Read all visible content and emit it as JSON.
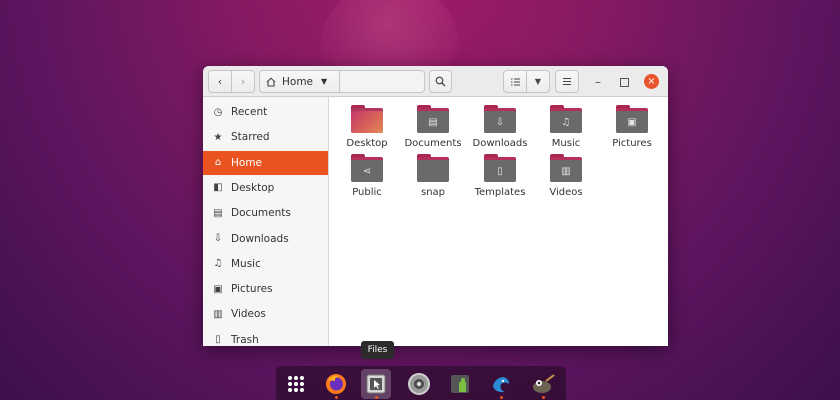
{
  "window": {
    "path_label": "Home",
    "close_glyph": "×",
    "min_glyph": "–",
    "back_glyph": "‹",
    "forward_glyph": "›"
  },
  "sidebar": {
    "items": [
      {
        "label": "Recent",
        "icon": "clock-icon",
        "glyph": "◷"
      },
      {
        "label": "Starred",
        "icon": "star-icon",
        "glyph": "★"
      },
      {
        "label": "Home",
        "icon": "home-icon",
        "glyph": "⌂"
      },
      {
        "label": "Desktop",
        "icon": "desktop-icon",
        "glyph": "◧"
      },
      {
        "label": "Documents",
        "icon": "documents-icon",
        "glyph": "▤"
      },
      {
        "label": "Downloads",
        "icon": "downloads-icon",
        "glyph": "⇩"
      },
      {
        "label": "Music",
        "icon": "music-icon",
        "glyph": "♫"
      },
      {
        "label": "Pictures",
        "icon": "pictures-icon",
        "glyph": "▣"
      },
      {
        "label": "Videos",
        "icon": "videos-icon",
        "glyph": "▥"
      },
      {
        "label": "Trash",
        "icon": "trash-icon",
        "glyph": "▯"
      }
    ],
    "active_index": 2
  },
  "files": [
    {
      "name": "Desktop",
      "icon": "desktop-folder-icon",
      "glyph": ""
    },
    {
      "name": "Documents",
      "icon": "documents-folder-icon",
      "glyph": "▤"
    },
    {
      "name": "Downloads",
      "icon": "downloads-folder-icon",
      "glyph": "⇩"
    },
    {
      "name": "Music",
      "icon": "music-folder-icon",
      "glyph": "♫"
    },
    {
      "name": "Pictures",
      "icon": "pictures-folder-icon",
      "glyph": "▣"
    },
    {
      "name": "Public",
      "icon": "public-folder-icon",
      "glyph": "⋖"
    },
    {
      "name": "snap",
      "icon": "folder-icon",
      "glyph": ""
    },
    {
      "name": "Templates",
      "icon": "templates-folder-icon",
      "glyph": "▯"
    },
    {
      "name": "Videos",
      "icon": "videos-folder-icon",
      "glyph": "▥"
    }
  ],
  "dock": {
    "tooltip": "Files",
    "items": [
      {
        "name": "show-applications-icon"
      },
      {
        "name": "firefox-icon"
      },
      {
        "name": "files-icon"
      },
      {
        "name": "settings-icon"
      },
      {
        "name": "extensions-icon"
      },
      {
        "name": "bird-app-icon"
      },
      {
        "name": "gimp-icon"
      }
    ]
  },
  "colors": {
    "accent": "#e95420",
    "folder_body": "#6a6a6a",
    "folder_back": "#b3305a"
  }
}
